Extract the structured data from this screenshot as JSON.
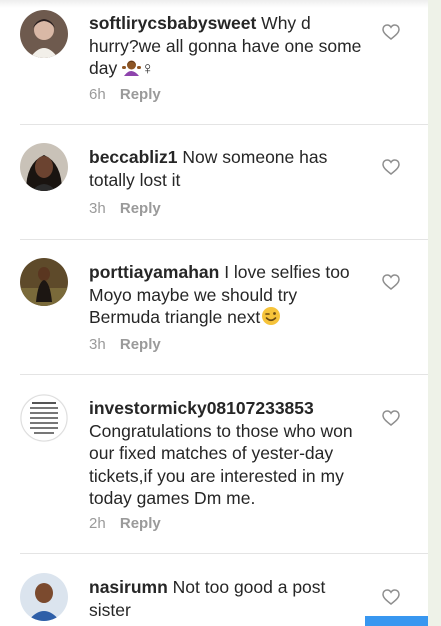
{
  "comments": [
    {
      "username": "softlirycsbabysweet",
      "text": "Why d hurry?we all gonna have one some day",
      "emoji": "person-shrugging-emoji",
      "suffix": "♀",
      "time": "6h",
      "reply_label": "Reply"
    },
    {
      "username": "beccabliz1",
      "text": "Now someone has totally lost it",
      "time": "3h",
      "reply_label": "Reply"
    },
    {
      "username": "porttiayamahan",
      "text": "I love selfies too Moyo maybe we should try Bermuda triangle next",
      "emoji": "winking-face-emoji",
      "time": "3h",
      "reply_label": "Reply"
    },
    {
      "username": "investormicky08107233853",
      "text": "Congratulations to those who won our fixed matches of yester-day tickets,if you are interested in my today games Dm me.",
      "time": "2h",
      "reply_label": "Reply"
    },
    {
      "username": "nasirumn",
      "text": "Not too good a post sister"
    }
  ],
  "icons": {
    "like": "heart-outline-icon"
  },
  "colors": {
    "text": "#262626",
    "meta": "#9a9a9a",
    "accent": "#3897f0"
  }
}
